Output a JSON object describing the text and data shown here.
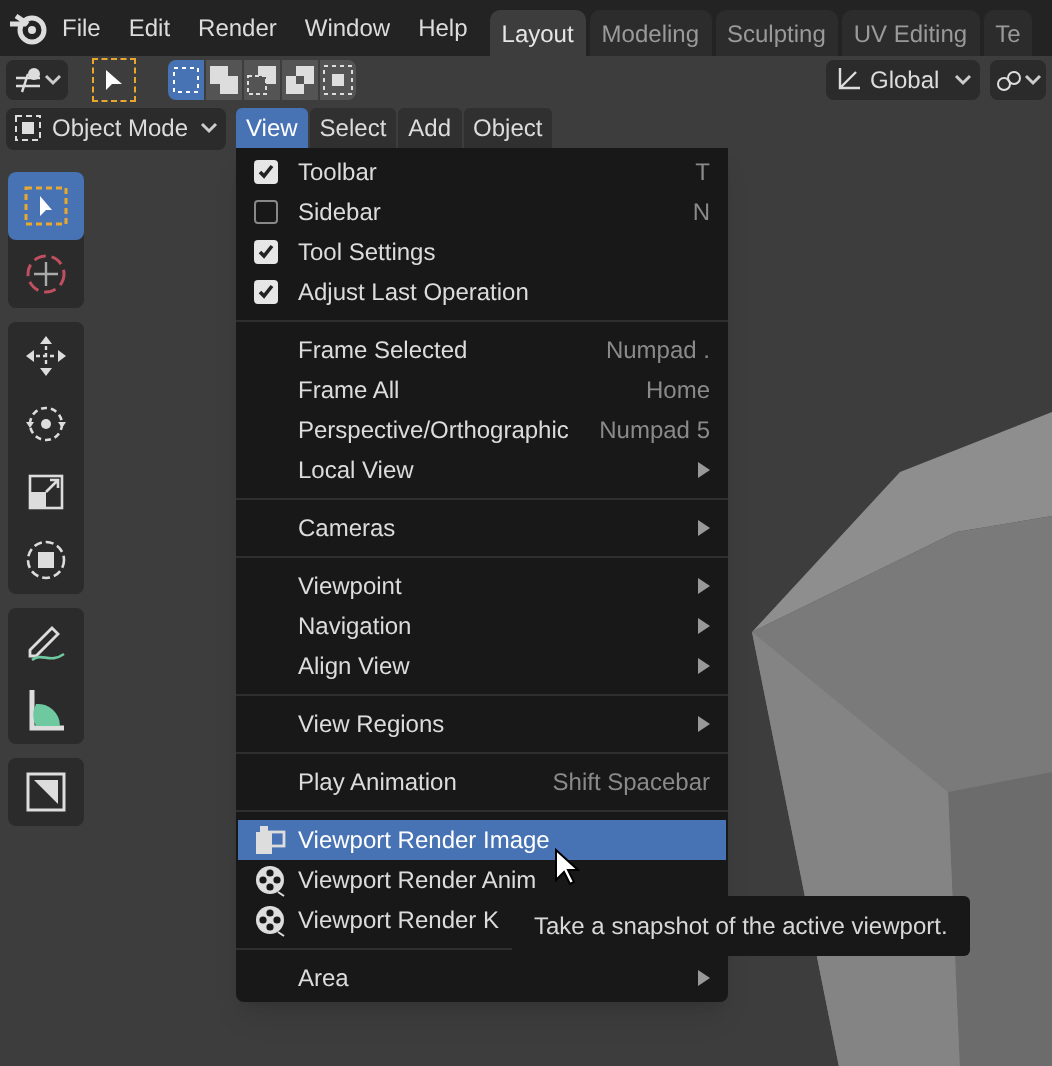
{
  "menubar": {
    "items": [
      "File",
      "Edit",
      "Render",
      "Window",
      "Help"
    ]
  },
  "workspace_tabs": [
    {
      "label": "Layout",
      "selected": true
    },
    {
      "label": "Modeling",
      "selected": false
    },
    {
      "label": "Sculpting",
      "selected": false
    },
    {
      "label": "UV Editing",
      "selected": false
    },
    {
      "label": "Te",
      "selected": false
    }
  ],
  "select_modes": [
    {
      "selected": true
    },
    {
      "selected": false
    },
    {
      "selected": false
    },
    {
      "selected": false
    },
    {
      "selected": false
    }
  ],
  "orientation": "Global",
  "mode": "Object Mode",
  "view_menus": [
    {
      "label": "View",
      "selected": true
    },
    {
      "label": "Select",
      "selected": false
    },
    {
      "label": "Add",
      "selected": false
    },
    {
      "label": "Object",
      "selected": false
    }
  ],
  "tool_groups": [
    [
      {
        "selected": true
      },
      {
        "selected": false
      }
    ],
    [
      {
        "selected": false
      },
      {
        "selected": false
      },
      {
        "selected": false
      },
      {
        "selected": false
      }
    ],
    [
      {
        "selected": false
      },
      {
        "selected": false
      }
    ],
    [
      {
        "selected": false
      }
    ]
  ],
  "menu": {
    "sections": [
      {
        "items": [
          {
            "kind": "check",
            "label": "Toolbar",
            "checked": true,
            "shortcut": "T",
            "selected": false
          },
          {
            "kind": "check",
            "label": "Sidebar",
            "checked": false,
            "shortcut": "N",
            "selected": false
          },
          {
            "kind": "check",
            "label": "Tool Settings",
            "checked": true,
            "selected": false
          },
          {
            "kind": "check",
            "label": "Adjust Last Operation",
            "checked": true,
            "selected": false
          }
        ]
      },
      {
        "items": [
          {
            "kind": "plain",
            "label": "Frame Selected",
            "shortcut": "Numpad .",
            "selected": false
          },
          {
            "kind": "plain",
            "label": "Frame All",
            "shortcut": "Home",
            "selected": false
          },
          {
            "kind": "plain",
            "label": "Perspective/Orthographic",
            "shortcut": "Numpad 5",
            "selected": false
          },
          {
            "kind": "plain",
            "label": "Local View",
            "submenu": true,
            "selected": false
          }
        ]
      },
      {
        "items": [
          {
            "kind": "plain",
            "label": "Cameras",
            "submenu": true,
            "selected": false
          }
        ]
      },
      {
        "items": [
          {
            "kind": "plain",
            "label": "Viewpoint",
            "submenu": true,
            "selected": false
          },
          {
            "kind": "plain",
            "label": "Navigation",
            "submenu": true,
            "selected": false
          },
          {
            "kind": "plain",
            "label": "Align View",
            "submenu": true,
            "selected": false
          }
        ]
      },
      {
        "items": [
          {
            "kind": "plain",
            "label": "View Regions",
            "submenu": true,
            "selected": false
          }
        ]
      },
      {
        "items": [
          {
            "kind": "plain",
            "label": "Play Animation",
            "shortcut": "Shift Spacebar",
            "selected": false
          }
        ]
      },
      {
        "items": [
          {
            "kind": "image",
            "label": "Viewport Render Image",
            "selected": true
          },
          {
            "kind": "film",
            "label": "Viewport Render Anim",
            "selected": false
          },
          {
            "kind": "film",
            "label": "Viewport Render K",
            "selected": false
          }
        ]
      },
      {
        "items": [
          {
            "kind": "plain",
            "label": "Area",
            "submenu": true,
            "selected": false
          }
        ]
      }
    ]
  },
  "tooltip": {
    "text": "Take a snapshot of the active viewport."
  }
}
